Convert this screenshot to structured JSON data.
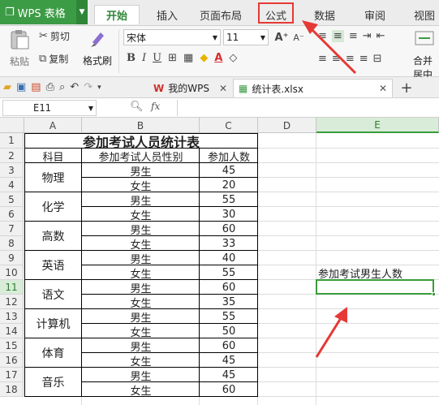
{
  "app": {
    "name": "WPS 表格"
  },
  "menu": {
    "tabs": [
      "开始",
      "插入",
      "页面布局",
      "公式",
      "数据",
      "审阅",
      "视图"
    ],
    "active": "开始",
    "highlighted": "公式"
  },
  "ribbon": {
    "paste": "粘贴",
    "cut": "剪切",
    "copy": "复制",
    "format_painter": "格式刷",
    "font_name": "宋体",
    "font_size": "11",
    "bold": "B",
    "italic": "I",
    "underline": "U",
    "merge_center": "合并居中"
  },
  "doc_tabs": [
    {
      "label": "我的WPS"
    },
    {
      "label": "统计表.xlsx"
    }
  ],
  "formula_bar": {
    "name_box": "E11",
    "fx": "fx",
    "value": ""
  },
  "columns": [
    "A",
    "B",
    "C",
    "D",
    "E"
  ],
  "rows": [
    "1",
    "2",
    "3",
    "4",
    "5",
    "6",
    "7",
    "8",
    "9",
    "10",
    "11",
    "12",
    "13",
    "14",
    "15",
    "16",
    "17",
    "18"
  ],
  "sheet": {
    "title": "参加考试人员统计表",
    "headers": [
      "科目",
      "参加考试人员性别",
      "参加人数"
    ],
    "subjects": [
      "物理",
      "化学",
      "高数",
      "英语",
      "语文",
      "计算机",
      "体育",
      "音乐"
    ],
    "genders": [
      "男生",
      "女生",
      "男生",
      "女生",
      "男生",
      "女生",
      "男生",
      "女生",
      "男生",
      "女生",
      "男生",
      "女生",
      "男生",
      "女生",
      "男生",
      "女生"
    ],
    "counts": [
      "45",
      "20",
      "55",
      "30",
      "60",
      "33",
      "40",
      "55",
      "60",
      "35",
      "55",
      "50",
      "60",
      "45",
      "45",
      "60"
    ],
    "e10_label": "参加考试男生人数"
  },
  "colors": {
    "accent": "#3c9b45",
    "arrow": "#e53935",
    "selection": "#3a9b3a"
  }
}
